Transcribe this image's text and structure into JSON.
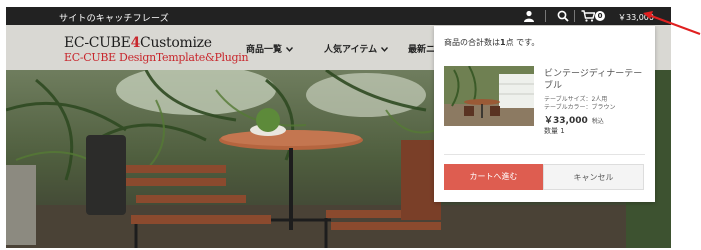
{
  "topbar": {
    "catchphrase": "サイトのキャッチフレーズ",
    "cart_count": "0",
    "cart_total": "￥33,000"
  },
  "header": {
    "logo_line1_prefix": "EC-CUBE",
    "logo_line1_accent": "4",
    "logo_line1_suffix": "Customize",
    "logo_line2": "EC-CUBE DesignTemplate&Plugin",
    "nav": [
      "商品一覧",
      "人気アイテム",
      "最新ニ"
    ]
  },
  "cart_popup": {
    "summary_prefix": "商品の合計数は",
    "summary_count": "1",
    "summary_suffix": "点 です。",
    "product": {
      "name": "ビンテージディナーテーブル",
      "option_size": "テーブルサイズ：2人用",
      "option_color": "テーブルカラー：ブラウン",
      "price": "￥33,000",
      "tax_label": "税込",
      "quantity": "数量 1"
    },
    "checkout_label": "カートへ進む",
    "cancel_label": "キャンセル"
  },
  "colors": {
    "topbar": "#222222",
    "header": "#d9d8d3",
    "brand_red": "#c8272d",
    "checkout_button": "#de5d50",
    "annotation_arrow": "#e02020"
  },
  "icons": [
    "user-icon",
    "search-icon",
    "cart-icon",
    "chevron-down-icon"
  ]
}
